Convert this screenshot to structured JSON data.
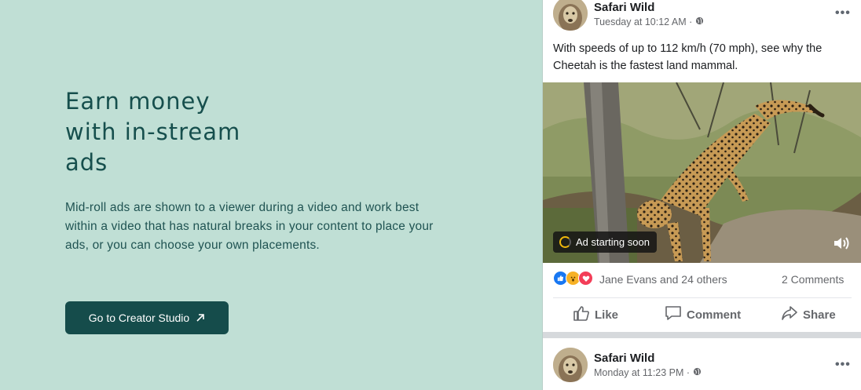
{
  "hero": {
    "title": "Earn money with in-stream ads",
    "description": "Mid-roll ads are shown to a viewer during a video and work best within a video that has natural breaks in your content to place your ads, or you can choose your own placements.",
    "cta_label": "Go to Creator Studio",
    "cta_icon": "arrow-up-right-icon"
  },
  "post1": {
    "page_name": "Safari Wild",
    "timestamp": "Tuesday at 10:12 AM ·",
    "privacy_icon": "globe-icon",
    "more_label": "•••",
    "text": "With speeds of up to 112 km/h (70 mph), see why the Cheetah is the fastest land mammal.",
    "video_overlay": "Ad starting soon",
    "reactions": [
      "like-icon",
      "wow-icon",
      "love-icon"
    ],
    "reactions_text": "Jane Evans and 24 others",
    "comments_count": "2 Comments",
    "actions": {
      "like": "Like",
      "comment": "Comment",
      "share": "Share"
    }
  },
  "post2": {
    "page_name": "Safari Wild",
    "timestamp": "Monday at 11:23 PM ·",
    "privacy_icon": "globe-icon",
    "more_label": "•••"
  },
  "colors": {
    "background": "#c0dfd5",
    "heading": "#164f4d",
    "cta_background": "#154c4b",
    "card": "#ffffff"
  }
}
